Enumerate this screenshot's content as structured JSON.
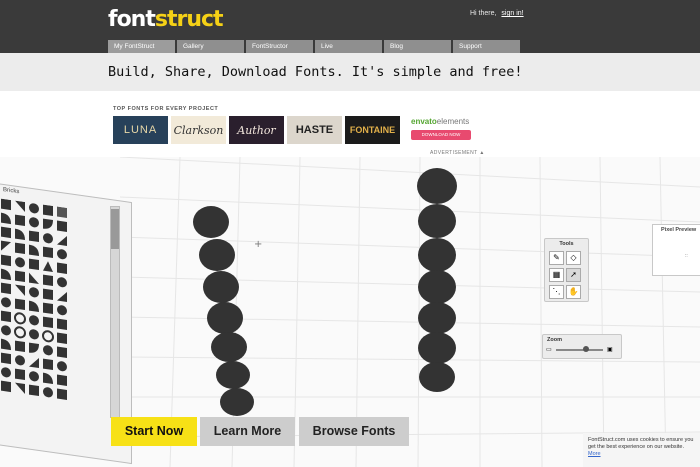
{
  "header": {
    "logo_part1": "font",
    "logo_part2": "struct",
    "greeting": "Hi there,",
    "sign_in": "sign in!"
  },
  "nav": {
    "items": [
      {
        "label": "My FontStruct"
      },
      {
        "label": "Gallery"
      },
      {
        "label": "FontStructor"
      },
      {
        "label": "Live"
      },
      {
        "label": "Blog"
      },
      {
        "label": "Support"
      }
    ]
  },
  "hero": {
    "tagline": "Build, Share, Download Fonts. It's simple and free!"
  },
  "ad": {
    "label": "TOP FONTS FOR EVERY PROJECT",
    "thumbnails": [
      {
        "text": "LUNA"
      },
      {
        "text": "Clarkson"
      },
      {
        "text": "Author"
      },
      {
        "text": "HASTE"
      },
      {
        "text": "FONTAINE"
      }
    ],
    "envato_brand": "envato",
    "envato_suffix": "elements",
    "download_label": "DOWNLOAD NOW",
    "advertisement_label": "ADVERTISEMENT"
  },
  "editor": {
    "tools_title": "Tools",
    "zoom_title": "Zoom",
    "pixel_preview_title": "Pixel Preview",
    "bricks_title": "Bricks"
  },
  "cta": {
    "start": "Start Now",
    "learn": "Learn More",
    "browse": "Browse Fonts"
  },
  "cookie": {
    "text": "FontStruct.com uses cookies to ensure you get the best experience on our website.",
    "more": "More"
  },
  "colors": {
    "header_bg": "#3a3a3a",
    "logo_accent": "#f5d116",
    "start_button": "#f7e116",
    "secondary_button": "#cdcdcd",
    "download_button": "#e84a6f"
  }
}
